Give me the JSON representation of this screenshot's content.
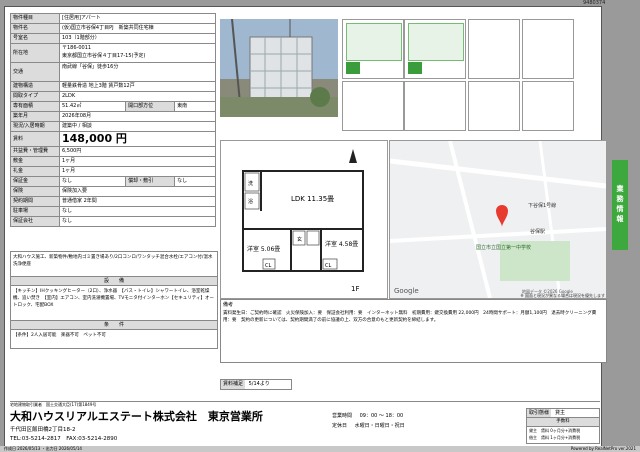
{
  "doc_number": "9480374",
  "property": {
    "type_label": "物件種目",
    "type_value": "[住居用]アパート",
    "name_label": "物件名",
    "name_value": "(仮)国立市谷保4丁目PJ　新築共同住宅棟",
    "room_label": "号室名",
    "room_value": "103（1階部分）",
    "address_label": "所在地",
    "zip": "〒186-0011",
    "address_value": "東京都国立市谷保４丁目17-15(予定)",
    "transport_label": "交通",
    "transport_value": "南武線「谷保」徒歩16分",
    "structure_label": "建物構造",
    "structure_value": "軽量鉄骨造 地上3階 賃戸数12戸",
    "layout_label": "間取タイプ",
    "layout_value": "2LDK",
    "area_label": "専有面積",
    "area_value": "51.42㎡",
    "opening_label": "開口部方位",
    "opening_value": "東南",
    "built_label": "築年月",
    "built_value": "2026年08月",
    "status_label": "現況/入居時期",
    "status_value": "建築中 / 相談",
    "rent_label": "賃料",
    "rent_value": "148,000 円",
    "mgmt_label": "共益費・管理費",
    "mgmt_value": "6,500円",
    "deposit_label": "敷金",
    "deposit_value": "1ヶ月",
    "keymoney_label": "礼金",
    "keymoney_value": "1ヶ月",
    "guarantee_label": "保証金",
    "guarantee_value": "なし",
    "amort_label": "償却・敷引",
    "amort_value": "なし",
    "insurance_label": "保険",
    "insurance_value": "保険加入要",
    "contract_label": "契約期間",
    "contract_value": "普通借家 2年間",
    "parking_label": "駐車場",
    "parking_value": "なし",
    "other_label": "保証会社",
    "other_value": "なし",
    "features_text": "大和ハウス施工、新築物件/敷地内ゴミ置き場あり/2口コンロ/ワンタッチ混合水栓/エアコン付/温水洗浄便座",
    "equipment_title": "設　　備",
    "equipment_text": "【キッチン】IHクッキングヒーター（2口）、浄水器　【バス・トイレ】シャワートイレ、浴室乾燥機、追い焚き　【室内】エアコン、室内洗濯機置場、TVモニタ付インターホン【セキュリティ】オートロック、宅配BOX",
    "conditions_title": "条　　件",
    "conditions_text": "【条件】2人入居可能　楽器不可　ペット不可"
  },
  "floorplan": {
    "rooms": [
      "LDK 11.35畳",
      "洋室 5.06畳",
      "洋室 4.58畳",
      "洗",
      "浴",
      "CL",
      "CL",
      "1F",
      "玄"
    ]
  },
  "map": {
    "labels": [
      "下谷保1号線",
      "谷保駅",
      "国立市立国立第一中学校",
      "Google"
    ],
    "copyright": "地図データ ©2026 Google"
  },
  "notes": {
    "caption": "※ 図面と現況が異なる場合は現況を優先します",
    "remarks_title": "備考",
    "remarks_text": "賃料発生日：ご契約時に確認　火災保険加入：要　保証会社利用：要　インターネット無料　初期費用：鍵交換費用 22,000円　24時間サポート：月額1,100円　退去時クリーニング費用：要　契約の更新については、契約期間満了の前に協議の上、双方の合意のもと更新契約を締結します。"
  },
  "small_box": {
    "label": "賃料補足",
    "value": "5/14より"
  },
  "side_tab": "業務情報",
  "footer": {
    "license": "宅地建物取引業者　国土交通大臣(17)第1849号",
    "company": "大和ハウスリアルエステート株式会社　東京営業所",
    "address": "千代田区飯田橋2丁目18-2",
    "phone": "TEL:03-5214-2817　FAX:03-5214-2890",
    "hours_label": "営業時間",
    "hours_value": "09：00 〜 18：00",
    "holiday_label": "定休日",
    "holiday_value": "水曜日・日曜日・祝日",
    "trade_label": "取引態様",
    "trade_value": "貸主",
    "fee_title": "手数料",
    "fee_rows": [
      [
        "貸主",
        "賃料 0ヶ月分+消費税"
      ],
      [
        "借主",
        "賃料 1ヶ月分+消費税"
      ]
    ]
  },
  "bottom_bar": {
    "left": "作成日 2026/05/13 ・出力日 2026/05/14",
    "right": "Powered by RealNetPro ver.2021"
  }
}
